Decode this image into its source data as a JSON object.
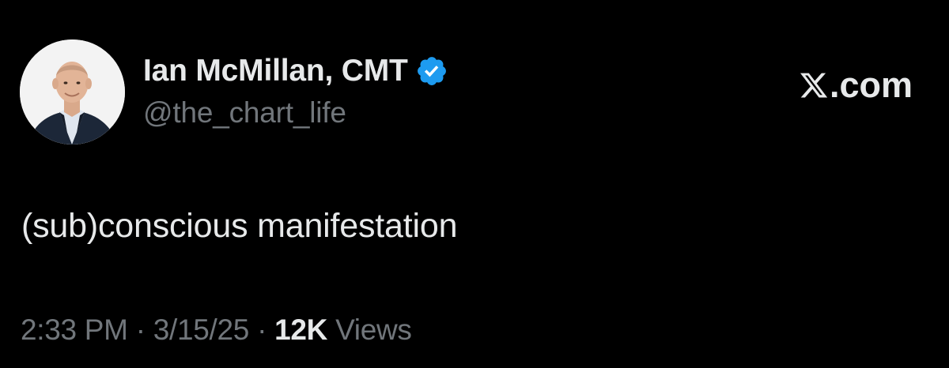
{
  "author": {
    "display_name": "Ian McMillan, CMT",
    "handle": "@the_chart_life",
    "verified": true,
    "verified_color": "#1d9bf0",
    "avatar_icon": "profile-photo"
  },
  "brand": {
    "logo_icon": "x-logo-icon",
    "suffix": ".com"
  },
  "tweet": {
    "text": "(sub)conscious manifestation"
  },
  "meta": {
    "time": "2:33 PM",
    "separator": "·",
    "date": "3/15/25",
    "views_count": "12K",
    "views_label": "Views"
  },
  "colors": {
    "background": "#000000",
    "primary_text": "#e7e9ea",
    "secondary_text": "#71767b",
    "accent": "#1d9bf0"
  }
}
